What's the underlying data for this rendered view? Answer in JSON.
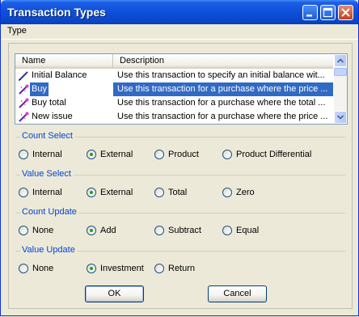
{
  "window": {
    "title": "Transaction Types"
  },
  "menu": {
    "items": [
      "Type"
    ]
  },
  "list": {
    "columns": [
      "Name",
      "Description"
    ],
    "rows": [
      {
        "name": "Initial Balance",
        "description": "Use this transaction to specify an initial balance wit...",
        "icon": "pencil-icon",
        "selected": false
      },
      {
        "name": "Buy",
        "description": "Use this transaction for a purchase where the price ...",
        "icon": "wand-icon",
        "selected": true
      },
      {
        "name": "Buy total",
        "description": "Use this transaction for a purchase where the total ...",
        "icon": "wand-icon",
        "selected": false
      },
      {
        "name": "New issue",
        "description": "Use this transaction for a purchase where the price ...",
        "icon": "wand-icon",
        "selected": false
      }
    ]
  },
  "groups": [
    {
      "title": "Count Select",
      "options": [
        "Internal",
        "External",
        "Product",
        "Product Differential"
      ],
      "selected": "External"
    },
    {
      "title": "Value Select",
      "options": [
        "Internal",
        "External",
        "Total",
        "Zero"
      ],
      "selected": "External"
    },
    {
      "title": "Count Update",
      "options": [
        "None",
        "Add",
        "Subtract",
        "Equal"
      ],
      "selected": "Add"
    },
    {
      "title": "Value Update",
      "options": [
        "None",
        "Investment",
        "Return"
      ],
      "selected": "Investment"
    }
  ],
  "buttons": {
    "ok": "OK",
    "cancel": "Cancel"
  },
  "colors": {
    "titlebar": "#0c4fd8",
    "selection": "#316ac5",
    "group_title": "#0046d5",
    "radio_dot": "#21a121"
  }
}
